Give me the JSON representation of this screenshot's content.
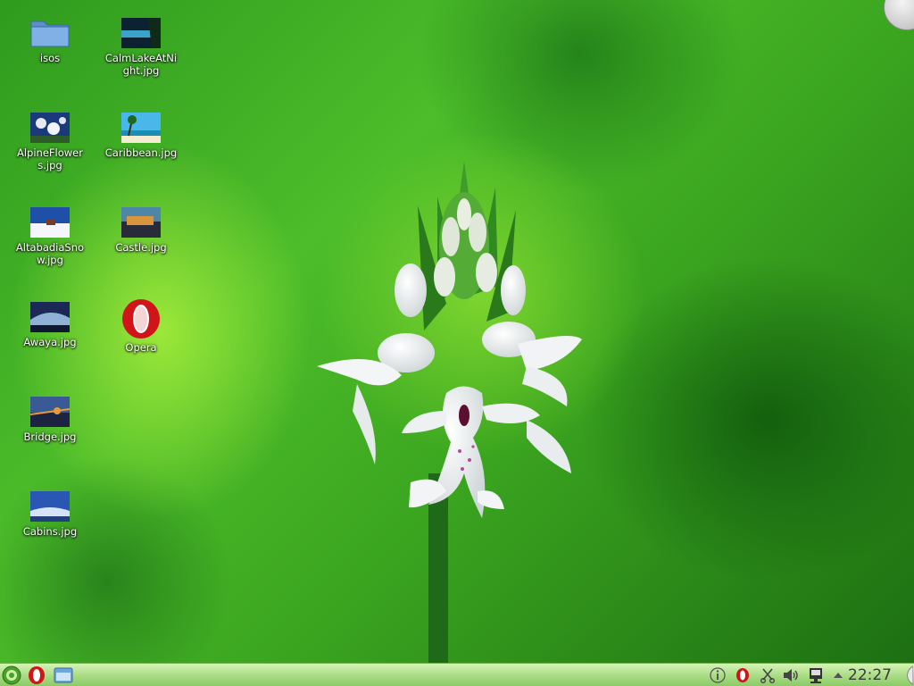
{
  "desktop": {
    "icons": [
      {
        "label": "isos",
        "kind": "folder"
      },
      {
        "label": "CalmLakeAtNight.jpg",
        "kind": "image",
        "colors": [
          "#0c2230",
          "#3aa5c9",
          "#102a1a"
        ]
      },
      {
        "label": "AlpineFlowers.jpg",
        "kind": "image",
        "colors": [
          "#1b3a7c",
          "#e7e9f3",
          "#2d5c2a"
        ]
      },
      {
        "label": "Caribbean.jpg",
        "kind": "image",
        "colors": [
          "#49b7ea",
          "#f3edd2",
          "#1a8fb6"
        ]
      },
      {
        "label": "AltabadiaSnow.jpg",
        "kind": "image",
        "colors": [
          "#1e4fa9",
          "#f4f6fb",
          "#c9d6ec"
        ]
      },
      {
        "label": "Castle.jpg",
        "kind": "image",
        "colors": [
          "#2a2b3a",
          "#d9953b",
          "#4d86a6"
        ]
      },
      {
        "label": "Awaya.jpg",
        "kind": "image",
        "colors": [
          "#1a2a55",
          "#8fb1d6",
          "#0e1830"
        ]
      },
      {
        "label": "Opera",
        "kind": "opera"
      },
      {
        "label": "Bridge.jpg",
        "kind": "image",
        "colors": [
          "#1c2442",
          "#e79a35",
          "#3a5a96"
        ]
      },
      {
        "label": "Cabins.jpg",
        "kind": "image",
        "colors": [
          "#2b57b4",
          "#d6e3f6",
          "#22407c"
        ]
      }
    ]
  },
  "panel": {
    "launchers": [
      {
        "icon": "kde-menu-icon"
      },
      {
        "icon": "opera-icon"
      },
      {
        "icon": "file-manager-icon"
      }
    ],
    "tray": [
      {
        "icon": "info-icon"
      },
      {
        "icon": "opera-tray-icon"
      },
      {
        "icon": "scissors-icon"
      },
      {
        "icon": "volume-icon"
      },
      {
        "icon": "network-icon"
      },
      {
        "icon": "arrow-up-icon"
      }
    ],
    "clock": "22:27"
  }
}
